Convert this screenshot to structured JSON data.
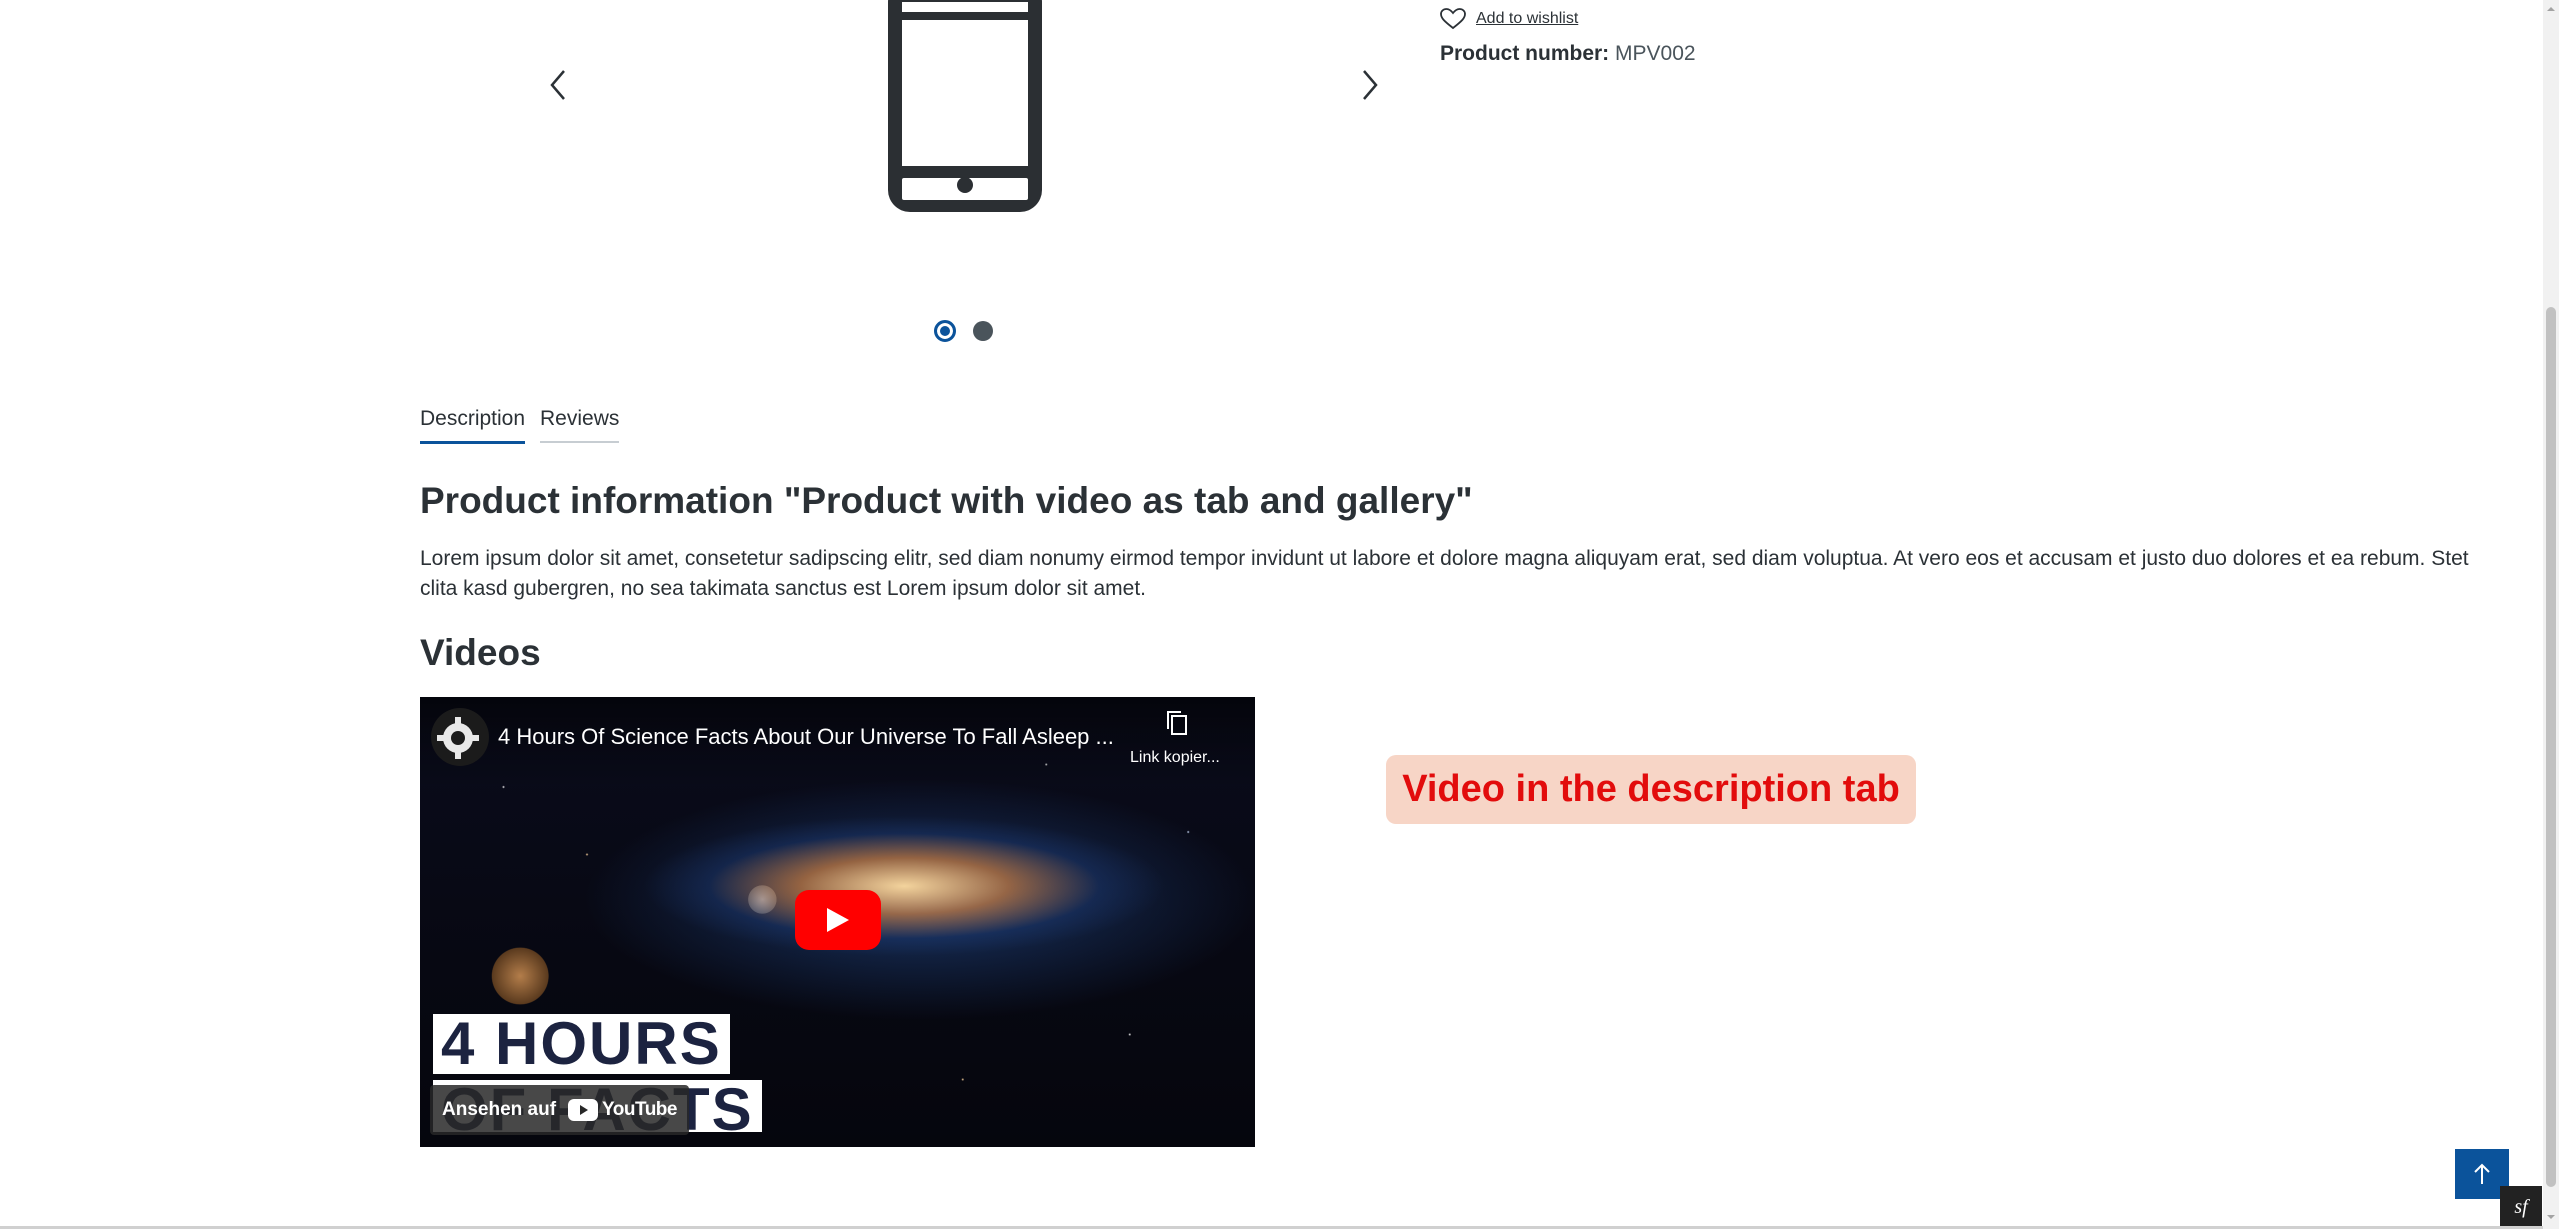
{
  "buy_box": {
    "wishlist_label": "Add to wishlist",
    "product_number_label": "Product number:",
    "product_number_value": "MPV002"
  },
  "gallery": {
    "slides_count": 2,
    "active_slide": 1
  },
  "tabs": [
    {
      "label": "Description",
      "active": true
    },
    {
      "label": "Reviews",
      "active": false
    }
  ],
  "description": {
    "heading": "Product information \"Product with video as tab and gallery\"",
    "text": "Lorem ipsum dolor sit amet, consetetur sadipscing elitr, sed diam nonumy eirmod tempor invidunt ut labore et dolore magna aliquyam erat, sed diam voluptua. At vero eos et accusam et justo duo dolores et ea rebum. Stet clita kasd gubergren, no sea takimata sanctus est Lorem ipsum dolor sit amet.",
    "videos_heading": "Videos"
  },
  "video": {
    "title": "4 Hours Of Science Facts About Our Universe To Fall Asleep ...",
    "copy_link_label": "Link kopier...",
    "overlay_line_1": "4 HOURS",
    "overlay_line_2": "OF FACTS",
    "watch_on_label": "Ansehen auf",
    "youtube_label": "YouTube"
  },
  "annotation": {
    "text": "Video in the description tab"
  },
  "colors": {
    "accent": "#0b539b",
    "text": "#2b3136",
    "annotation_bg": "#f7d5c6",
    "annotation_text": "#e20c0c",
    "youtube_red": "#ff0000"
  }
}
